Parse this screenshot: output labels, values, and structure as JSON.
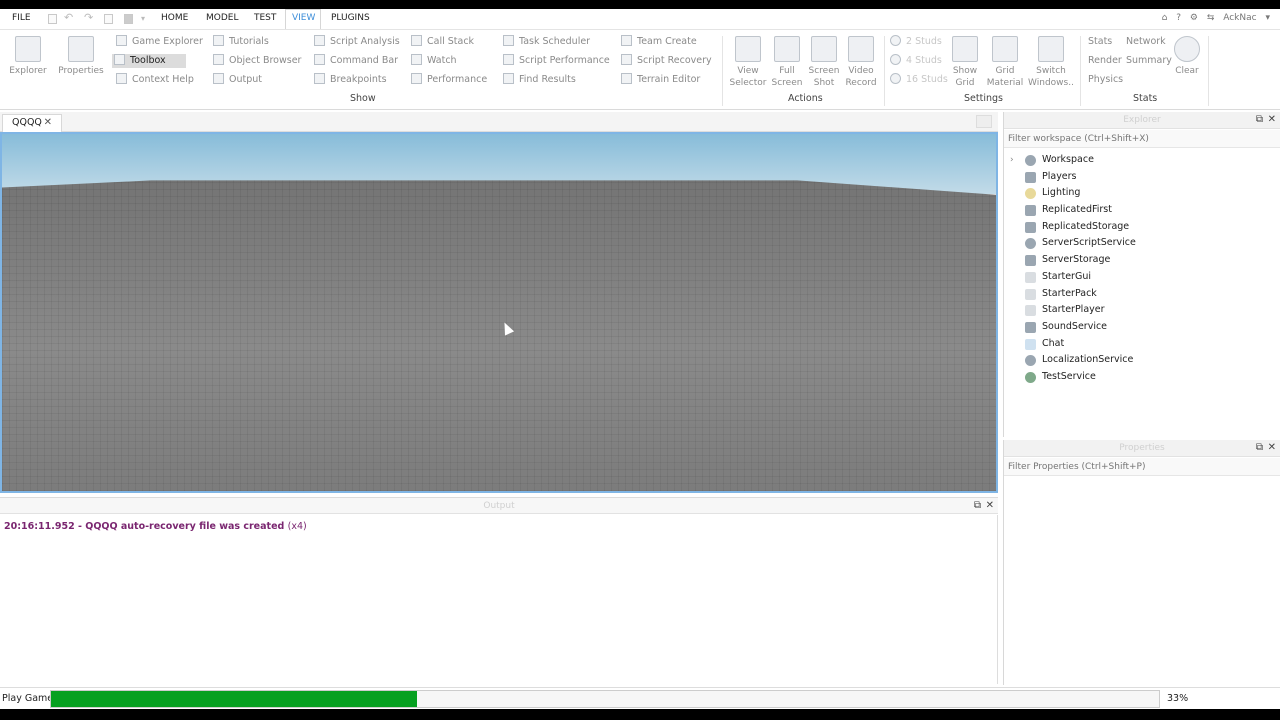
{
  "menu": {
    "file": "FILE",
    "tabs": [
      "HOME",
      "MODEL",
      "TEST",
      "VIEW",
      "PLUGINS"
    ],
    "active_tab": "VIEW",
    "user": "AckNac"
  },
  "ribbon": {
    "big_buttons": [
      {
        "label": "Explorer",
        "icon": "explorer-icon"
      },
      {
        "label": "Properties",
        "icon": "properties-icon"
      }
    ],
    "show_items_col1": [
      {
        "label": "Game Explorer",
        "icon": "game-explorer-icon"
      },
      {
        "label": "Toolbox",
        "icon": "toolbox-icon",
        "selected": true
      },
      {
        "label": "Context Help",
        "icon": "context-help-icon"
      }
    ],
    "show_items_col2": [
      {
        "label": "Tutorials",
        "icon": "tutorials-icon"
      },
      {
        "label": "Object Browser",
        "icon": "object-browser-icon"
      },
      {
        "label": "Output",
        "icon": "output-icon"
      }
    ],
    "show_items_col3": [
      {
        "label": "Script Analysis",
        "icon": "script-analysis-icon"
      },
      {
        "label": "Command Bar",
        "icon": "command-bar-icon"
      },
      {
        "label": "Breakpoints",
        "icon": "breakpoints-icon"
      }
    ],
    "show_items_col4": [
      {
        "label": "Call Stack",
        "icon": "call-stack-icon"
      },
      {
        "label": "Watch",
        "icon": "watch-icon"
      },
      {
        "label": "Performance",
        "icon": "performance-icon"
      }
    ],
    "show_items_col5": [
      {
        "label": "Task Scheduler",
        "icon": "task-scheduler-icon"
      },
      {
        "label": "Script Performance",
        "icon": "script-performance-icon"
      },
      {
        "label": "Find Results",
        "icon": "find-results-icon"
      }
    ],
    "show_items_col6": [
      {
        "label": "Team Create",
        "icon": "team-create-icon"
      },
      {
        "label": "Script Recovery",
        "icon": "script-recovery-icon"
      },
      {
        "label": "Terrain Editor",
        "icon": "terrain-editor-icon"
      }
    ],
    "show_group": "Show",
    "actions": [
      {
        "line1": "View",
        "line2": "Selector",
        "icon": "view-selector-icon"
      },
      {
        "line1": "Full",
        "line2": "Screen",
        "icon": "full-screen-icon"
      },
      {
        "line1": "Screen",
        "line2": "Shot",
        "icon": "screenshot-icon"
      },
      {
        "line1": "Video",
        "line2": "Record",
        "icon": "video-record-icon"
      }
    ],
    "actions_group": "Actions",
    "studs": [
      "2 Studs",
      "4 Studs",
      "16 Studs"
    ],
    "settings_buttons": [
      {
        "line1": "Show",
        "line2": "Grid",
        "icon": "show-grid-icon"
      },
      {
        "line1": "Grid",
        "line2": "Material",
        "icon": "grid-material-icon"
      },
      {
        "line1": "Switch",
        "line2": "Windows..",
        "icon": "switch-windows-icon"
      }
    ],
    "settings_group": "Settings",
    "stats_items": [
      "Stats",
      "Network",
      "Render",
      "Summary",
      "Physics"
    ],
    "clear_label": "Clear",
    "stats_group": "Stats"
  },
  "document": {
    "tab": "QQQQ"
  },
  "output": {
    "title": "Output",
    "lines": [
      {
        "text": "20:16:11.952 - QQQQ auto-recovery file was created",
        "count": "(x4)"
      }
    ]
  },
  "explorer": {
    "title": "Explorer",
    "filter_placeholder": "Filter workspace (Ctrl+Shift+X)",
    "items": [
      {
        "label": "Workspace",
        "icon": "workspace-icon",
        "expandable": true
      },
      {
        "label": "Players",
        "icon": "players-icon"
      },
      {
        "label": "Lighting",
        "icon": "lighting-icon"
      },
      {
        "label": "ReplicatedFirst",
        "icon": "replicated-first-icon"
      },
      {
        "label": "ReplicatedStorage",
        "icon": "replicated-storage-icon"
      },
      {
        "label": "ServerScriptService",
        "icon": "server-script-service-icon"
      },
      {
        "label": "ServerStorage",
        "icon": "server-storage-icon"
      },
      {
        "label": "StarterGui",
        "icon": "starter-gui-icon"
      },
      {
        "label": "StarterPack",
        "icon": "starter-pack-icon"
      },
      {
        "label": "StarterPlayer",
        "icon": "starter-player-icon"
      },
      {
        "label": "SoundService",
        "icon": "sound-service-icon"
      },
      {
        "label": "Chat",
        "icon": "chat-icon"
      },
      {
        "label": "LocalizationService",
        "icon": "localization-service-icon"
      },
      {
        "label": "TestService",
        "icon": "test-service-icon"
      }
    ]
  },
  "properties": {
    "title": "Properties",
    "filter_placeholder": "Filter Properties (Ctrl+Shift+P)"
  },
  "status": {
    "label": "Play Game",
    "progress_fraction": 0.33,
    "percent_text": "33%"
  },
  "colors": {
    "accent": "#3d8ed9",
    "progress": "#06a020",
    "output_text": "#7a2670"
  }
}
